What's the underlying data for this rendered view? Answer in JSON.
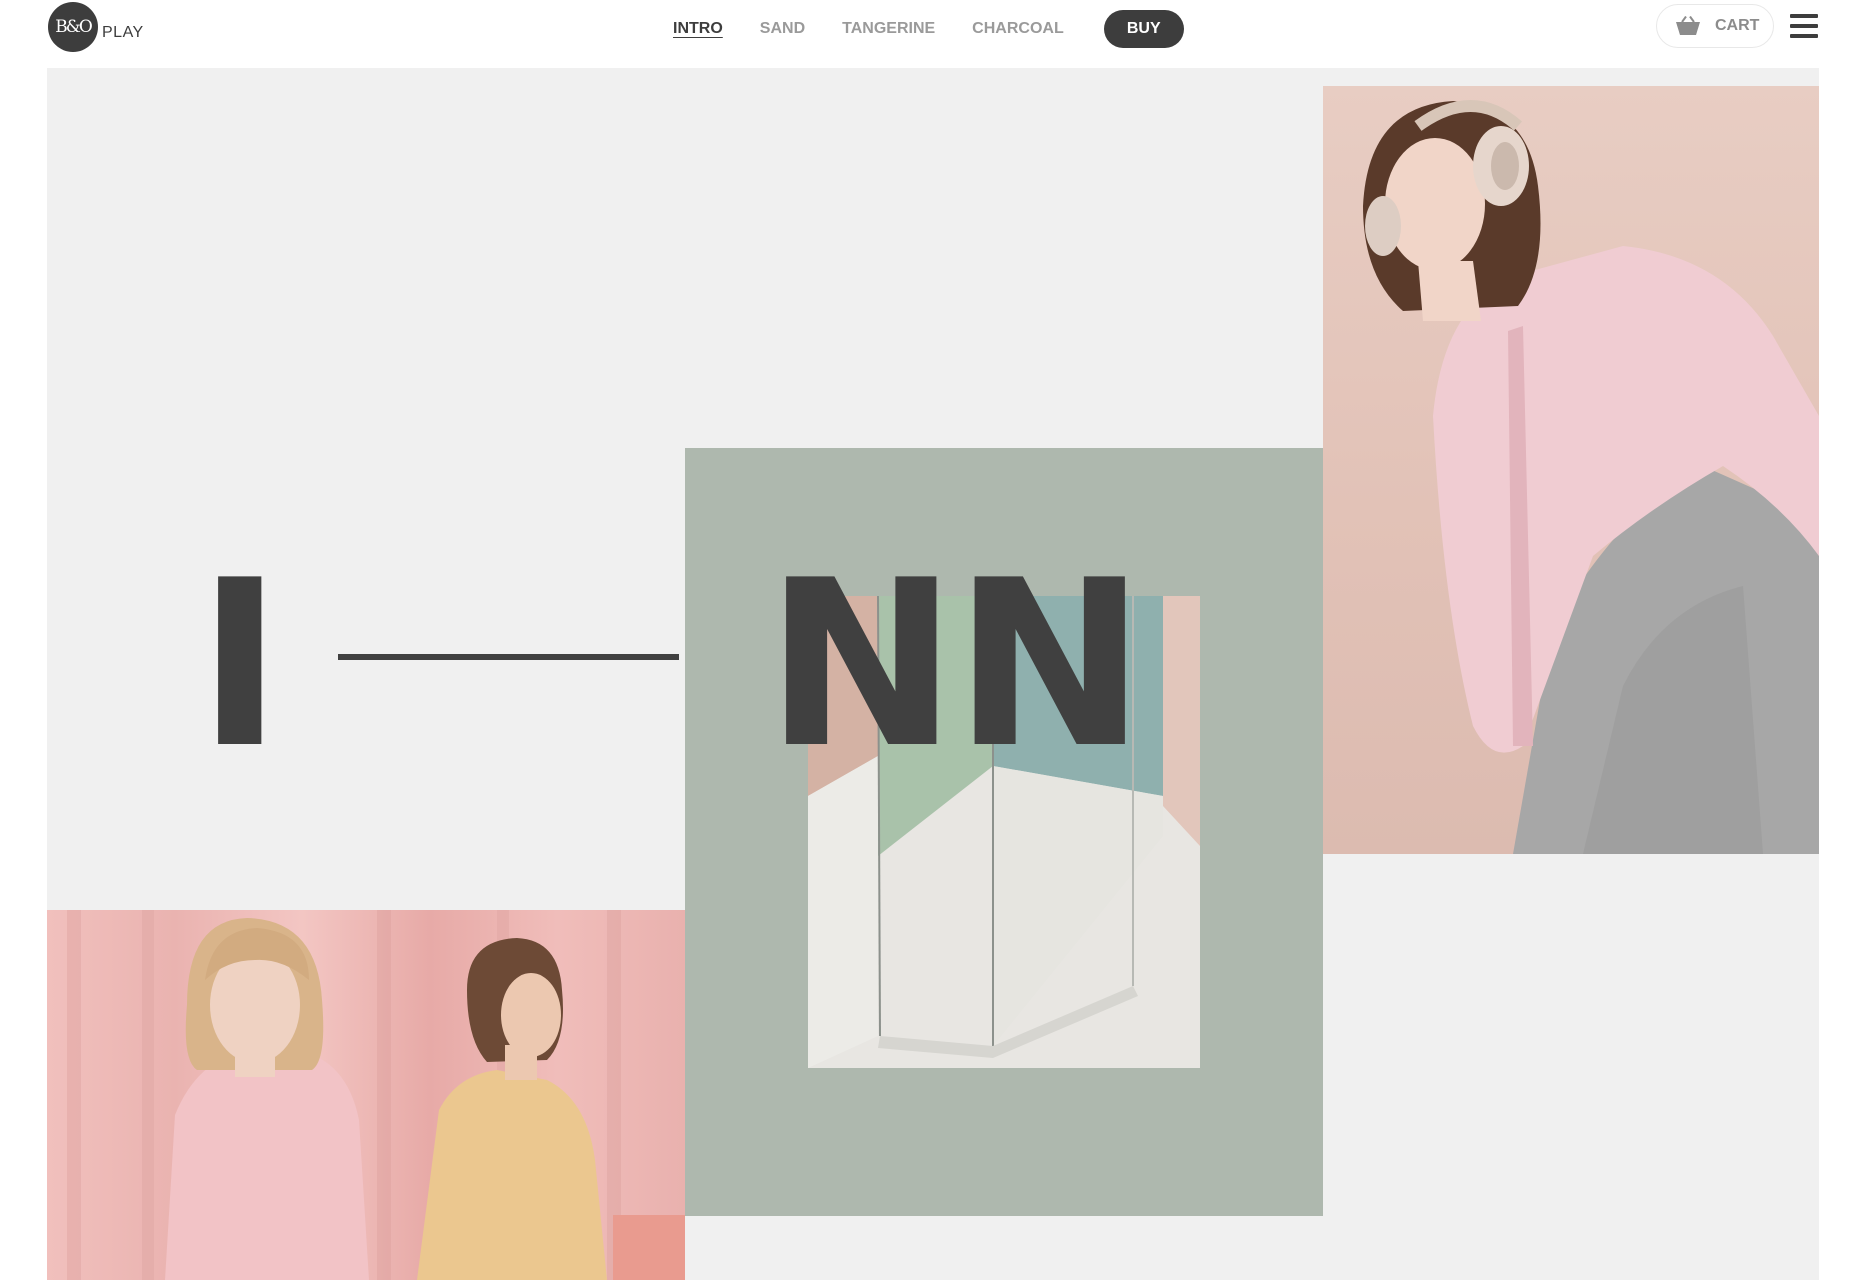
{
  "header": {
    "logo": {
      "mark": "B&O",
      "text": "PLAY"
    },
    "nav": [
      {
        "label": "INTRO",
        "active": true
      },
      {
        "label": "SAND",
        "active": false
      },
      {
        "label": "TANGERINE",
        "active": false
      },
      {
        "label": "CHARCOAL",
        "active": false
      }
    ],
    "buy_label": "BUY",
    "cart_label": "CART",
    "cart_icon": "basket-icon",
    "menu_icon": "hamburger-icon"
  },
  "hero": {
    "letter_left": "I",
    "letters_right": "NN"
  },
  "colors": {
    "text_dark": "#3d3d3d",
    "nav_inactive": "#9a9a9a",
    "canvas_bg": "#f0f0f0",
    "sage_panel": "#aeb8ae",
    "accent_pink": "#efbcb9"
  }
}
